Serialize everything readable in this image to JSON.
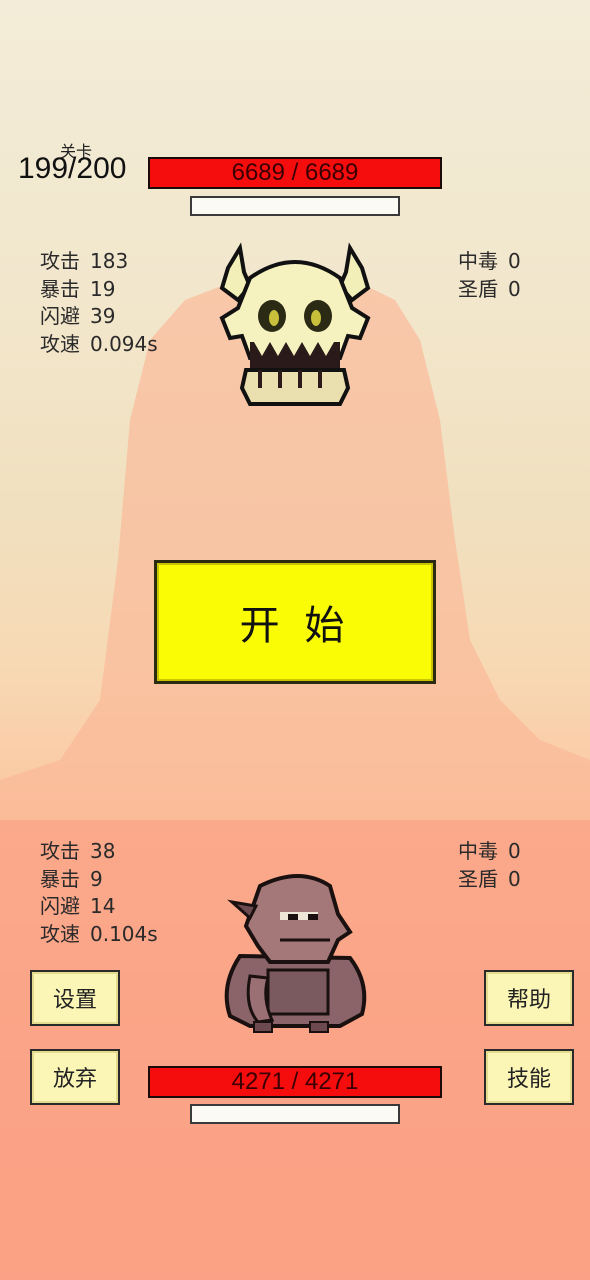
{
  "level": {
    "label": "关卡",
    "value": "199/200"
  },
  "enemy": {
    "hp_text": "6689 / 6689",
    "stats": [
      {
        "label": "攻击",
        "value": "183"
      },
      {
        "label": "暴击",
        "value": "19"
      },
      {
        "label": "闪避",
        "value": "39"
      },
      {
        "label": "攻速",
        "value": "0.094s"
      }
    ],
    "effects": [
      {
        "label": "中毒",
        "value": "0"
      },
      {
        "label": "圣盾",
        "value": "0"
      }
    ]
  },
  "player": {
    "hp_text": "4271 / 4271",
    "stats": [
      {
        "label": "攻击",
        "value": "38"
      },
      {
        "label": "暴击",
        "value": "9"
      },
      {
        "label": "闪避",
        "value": "14"
      },
      {
        "label": "攻速",
        "value": "0.104s"
      }
    ],
    "effects": [
      {
        "label": "中毒",
        "value": "0"
      },
      {
        "label": "圣盾",
        "value": "0"
      }
    ]
  },
  "buttons": {
    "start": "开 始",
    "settings": "设置",
    "give_up": "放弃",
    "help": "帮助",
    "skills": "技能"
  },
  "sprites": {
    "enemy": "horned-skull-monster",
    "player": "hooded-blob-creature"
  },
  "colors": {
    "hp_bar": "#f50d0d",
    "start_button": "#fafc05",
    "side_button": "#fbf6b6"
  }
}
